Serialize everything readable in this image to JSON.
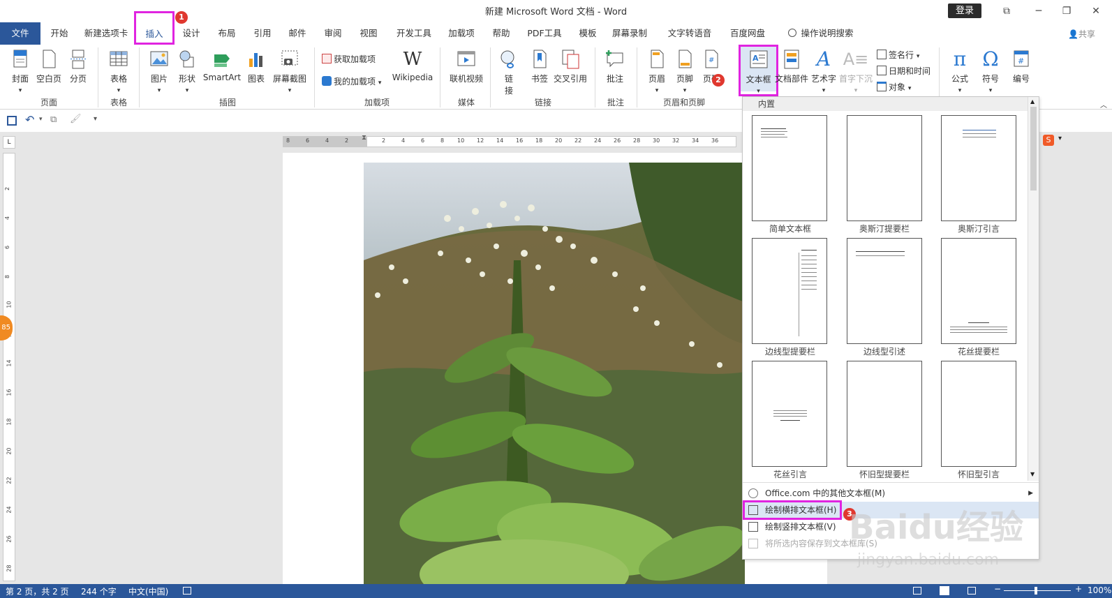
{
  "window": {
    "title": "新建 Microsoft Word 文档  -  Word",
    "login": "登录",
    "controls": [
      "⧉",
      "─",
      "❐",
      "✕"
    ]
  },
  "tabs": [
    "文件",
    "开始",
    "新建选项卡",
    "插入",
    "设计",
    "布局",
    "引用",
    "邮件",
    "审阅",
    "视图",
    "开发工具",
    "加载项",
    "帮助",
    "PDF工具",
    "模板",
    "屏幕录制",
    "文字转语音",
    "百度网盘",
    "操作说明搜索"
  ],
  "share": "共享",
  "badges": [
    "1",
    "2",
    "3"
  ],
  "ribbon": {
    "cover": "封面",
    "blank": "空白页",
    "break": "分页",
    "table": "表格",
    "picture": "图片",
    "shape": "形状",
    "smartart": "SmartArt",
    "chart": "图表",
    "screenshot": "屏幕截图",
    "get_addins": "获取加载项",
    "my_addins": "我的加载项",
    "wikipedia": "Wikipedia",
    "online_video": "联机视频",
    "link1": "链",
    "link2": "接",
    "bookmark": "书签",
    "crossref": "交叉引用",
    "comment": "批注",
    "header": "页眉",
    "footer": "页脚",
    "pagenum": "页码",
    "textbox": "文本框",
    "quickparts": "文档部件",
    "wordart": "艺术字",
    "dropcap": "首字下沉",
    "signature": "签名行",
    "datetime": "日期和时间",
    "object": "对象",
    "equation": "公式",
    "symbol": "符号",
    "number": "编号",
    "groups": [
      "页面",
      "表格",
      "插图",
      "加载项",
      "媒体",
      "链接",
      "批注",
      "页眉和页脚"
    ]
  },
  "dropdown": {
    "header": "内置",
    "items": [
      "简单文本框",
      "奥斯汀提要栏",
      "奥斯汀引言",
      "边线型提要栏",
      "边线型引述",
      "花丝提要栏",
      "花丝引言",
      "怀旧型提要栏",
      "怀旧型引言"
    ],
    "menu": [
      "Office.com 中的其他文本框(M)",
      "绘制横排文本框(H)",
      "绘制竖排文本框(V)",
      "将所选内容保存到文本框库(S)"
    ]
  },
  "ruler": {
    "h": [
      "8",
      "6",
      "4",
      "2",
      "2",
      "4",
      "6",
      "8",
      "10",
      "12",
      "14",
      "16",
      "18",
      "20",
      "22",
      "24",
      "26",
      "28",
      "30",
      "32",
      "34",
      "36"
    ],
    "v": [
      "2",
      "4",
      "6",
      "8",
      "10",
      "12",
      "14",
      "16",
      "18",
      "20",
      "22",
      "24",
      "26",
      "28"
    ]
  },
  "status": {
    "page": "第 2 页，共 2 页",
    "words": "244 个字",
    "lang": "中文(中国)",
    "zoom": "100%"
  },
  "side_badge": "85",
  "watermark": {
    "main": "Baidu经验",
    "url": "jingyan.baidu.com"
  },
  "colors": {
    "accent": "#2b579a",
    "highlight": "#e024e0",
    "badge": "#e0382f"
  }
}
